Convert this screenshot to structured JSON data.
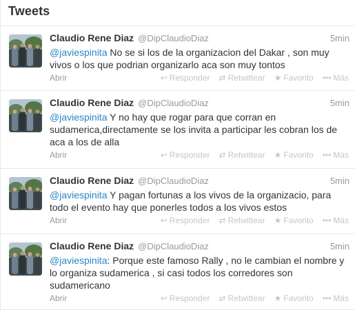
{
  "stream": {
    "title": "Tweets"
  },
  "tweets": [
    {
      "fullname": "Claudio Rene Diaz",
      "username": "@DipClaudioDiaz",
      "time": "5min",
      "mention": "@javiespinita",
      "text": "  No se si los de la organizacion del Dakar , son muy vivos o los que podrian organizarlo aca son muy tontos",
      "expand": "Abrir"
    },
    {
      "fullname": "Claudio Rene Diaz",
      "username": "@DipClaudioDiaz",
      "time": "5min",
      "mention": "@javiespinita",
      "text": " Y no hay que rogar para que corran en sudamerica,directamente se los invita a participar les cobran los de aca a los de alla",
      "expand": "Abrir"
    },
    {
      "fullname": "Claudio Rene Diaz",
      "username": "@DipClaudioDiaz",
      "time": "5min",
      "mention": "@javiespinita",
      "text": " Y pagan fortunas a los vivos de la organizacio, para todo el evento hay que ponerles todos a los vivos estos",
      "expand": "Abrir"
    },
    {
      "fullname": "Claudio Rene Diaz",
      "username": "@DipClaudioDiaz",
      "time": "5min",
      "mention": "@javiespinita",
      "text": ": Porque este famoso Rally , no le cambian el nombre y lo organiza sudamerica , si casi todos los corredores son sudamericano",
      "expand": "Abrir"
    }
  ],
  "actions": {
    "reply": "Responder",
    "retweet": "Retwittear",
    "favorite": "Favorito",
    "more": "Más",
    "reply_icon": "reply-icon",
    "retweet_icon": "retweet-icon",
    "favorite_icon": "star-icon",
    "more_icon": "more-dots-icon"
  },
  "colors": {
    "link": "#2a86c6",
    "text": "#333333",
    "muted": "#999999",
    "divider": "#e8e8e8"
  }
}
